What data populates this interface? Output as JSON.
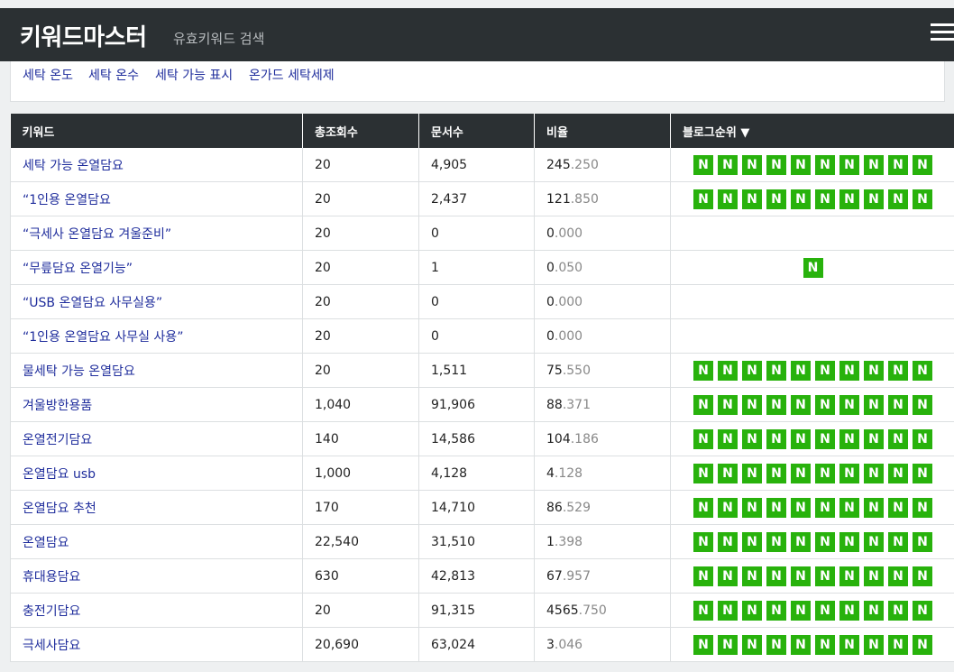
{
  "header": {
    "brand": "키워드마스터",
    "subtitle": "유효키워드 검색"
  },
  "tags": [
    "세탁 온도",
    "세탁 온수",
    "세탁 가능 표시",
    "온가드 세탁세제"
  ],
  "table": {
    "columns": [
      "키워드",
      "총조회수",
      "문서수",
      "비율",
      "블로그순위 ▼"
    ],
    "badge_label": "N",
    "rows": [
      {
        "keyword": "세탁 가능 온열담요",
        "views": "20",
        "docs": "4,905",
        "ratio_int": "245",
        "ratio_dec": ".250",
        "badges": 10
      },
      {
        "keyword": "“1인용 온열담요",
        "views": "20",
        "docs": "2,437",
        "ratio_int": "121",
        "ratio_dec": ".850",
        "badges": 10
      },
      {
        "keyword": "“극세사 온열담요 겨울준비”",
        "views": "20",
        "docs": "0",
        "ratio_int": "0",
        "ratio_dec": ".000",
        "badges": 0
      },
      {
        "keyword": "“무릎담요 온열기능”",
        "views": "20",
        "docs": "1",
        "ratio_int": "0",
        "ratio_dec": ".050",
        "badges": 1
      },
      {
        "keyword": "“USB 온열담요 사무실용”",
        "views": "20",
        "docs": "0",
        "ratio_int": "0",
        "ratio_dec": ".000",
        "badges": 0
      },
      {
        "keyword": "“1인용 온열담요 사무실 사용”",
        "views": "20",
        "docs": "0",
        "ratio_int": "0",
        "ratio_dec": ".000",
        "badges": 0
      },
      {
        "keyword": "물세탁 가능 온열담요",
        "views": "20",
        "docs": "1,511",
        "ratio_int": "75",
        "ratio_dec": ".550",
        "badges": 10
      },
      {
        "keyword": "겨울방한용품",
        "views": "1,040",
        "docs": "91,906",
        "ratio_int": "88",
        "ratio_dec": ".371",
        "badges": 10
      },
      {
        "keyword": "온열전기담요",
        "views": "140",
        "docs": "14,586",
        "ratio_int": "104",
        "ratio_dec": ".186",
        "badges": 10
      },
      {
        "keyword": "온열담요 usb",
        "views": "1,000",
        "docs": "4,128",
        "ratio_int": "4",
        "ratio_dec": ".128",
        "badges": 10
      },
      {
        "keyword": "온열담요 추천",
        "views": "170",
        "docs": "14,710",
        "ratio_int": "86",
        "ratio_dec": ".529",
        "badges": 10
      },
      {
        "keyword": "온열담요",
        "views": "22,540",
        "docs": "31,510",
        "ratio_int": "1",
        "ratio_dec": ".398",
        "badges": 10
      },
      {
        "keyword": "휴대용담요",
        "views": "630",
        "docs": "42,813",
        "ratio_int": "67",
        "ratio_dec": ".957",
        "badges": 10
      },
      {
        "keyword": "충전기담요",
        "views": "20",
        "docs": "91,315",
        "ratio_int": "4565",
        "ratio_dec": ".750",
        "badges": 10
      },
      {
        "keyword": "극세사담요",
        "views": "20,690",
        "docs": "63,024",
        "ratio_int": "3",
        "ratio_dec": ".046",
        "badges": 10
      }
    ]
  },
  "colors": {
    "navbar": "#2b3033",
    "link": "#1f2d9c",
    "badge": "#28b20c"
  }
}
